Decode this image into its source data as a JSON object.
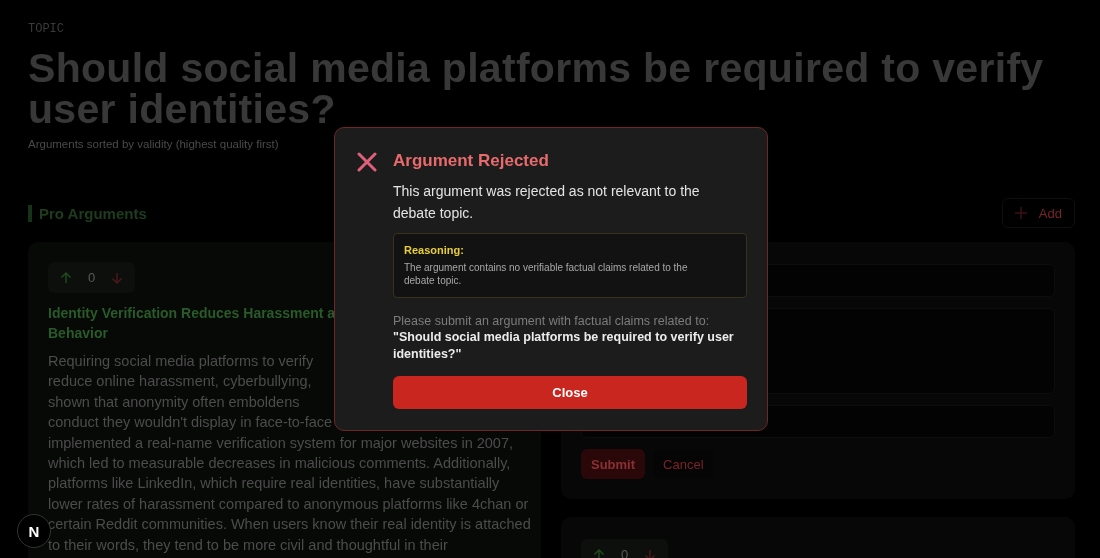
{
  "topic_label": "TOPIC",
  "topic": "Should social media platforms be required to verify user identities?",
  "subtitle": "Arguments sorted by validity (highest quality first)",
  "pro": {
    "heading": "Pro Arguments",
    "arguments": [
      {
        "score": "0",
        "title_lines": [
          "Identity Verification Reduces Harassment a",
          "Behavior"
        ],
        "body_lines": [
          "Requiring social media platforms to verify",
          "reduce online harassment, cyberbullying,",
          "shown that anonymity often emboldens",
          "conduct they wouldn't display in face-to-face",
          "implemented a real-name verification system for major websites in 2007,",
          "which led to measurable decreases in malicious comments. Additionally,",
          "platforms like LinkedIn, which require real identities, have substantially",
          "lower rates of harassment compared to anonymous platforms like 4chan or",
          "certain Reddit communities. When users know their real identity is attached",
          "to their words, they tend to be more civil and thoughtful in their"
        ]
      }
    ]
  },
  "con": {
    "add_button": "Add",
    "form": {
      "buttons": [
        {
          "kind": "primary",
          "label": "Submit"
        },
        {
          "kind": "secondary",
          "label": "Cancel"
        }
      ]
    },
    "arguments": [
      {
        "score": "0"
      }
    ]
  },
  "modal": {
    "title": "Argument Rejected",
    "message": "This argument was rejected as not relevant to the debate topic.",
    "reasoning_label": "Reasoning:",
    "reasoning": "The argument contains no verifiable factual claims related to the debate topic.",
    "hint": "Please submit an argument with factual claims related to:",
    "quote": "\"Should social media platforms be required to verify user identities?\"",
    "close_button": "Close"
  },
  "dev_badge": "N"
}
